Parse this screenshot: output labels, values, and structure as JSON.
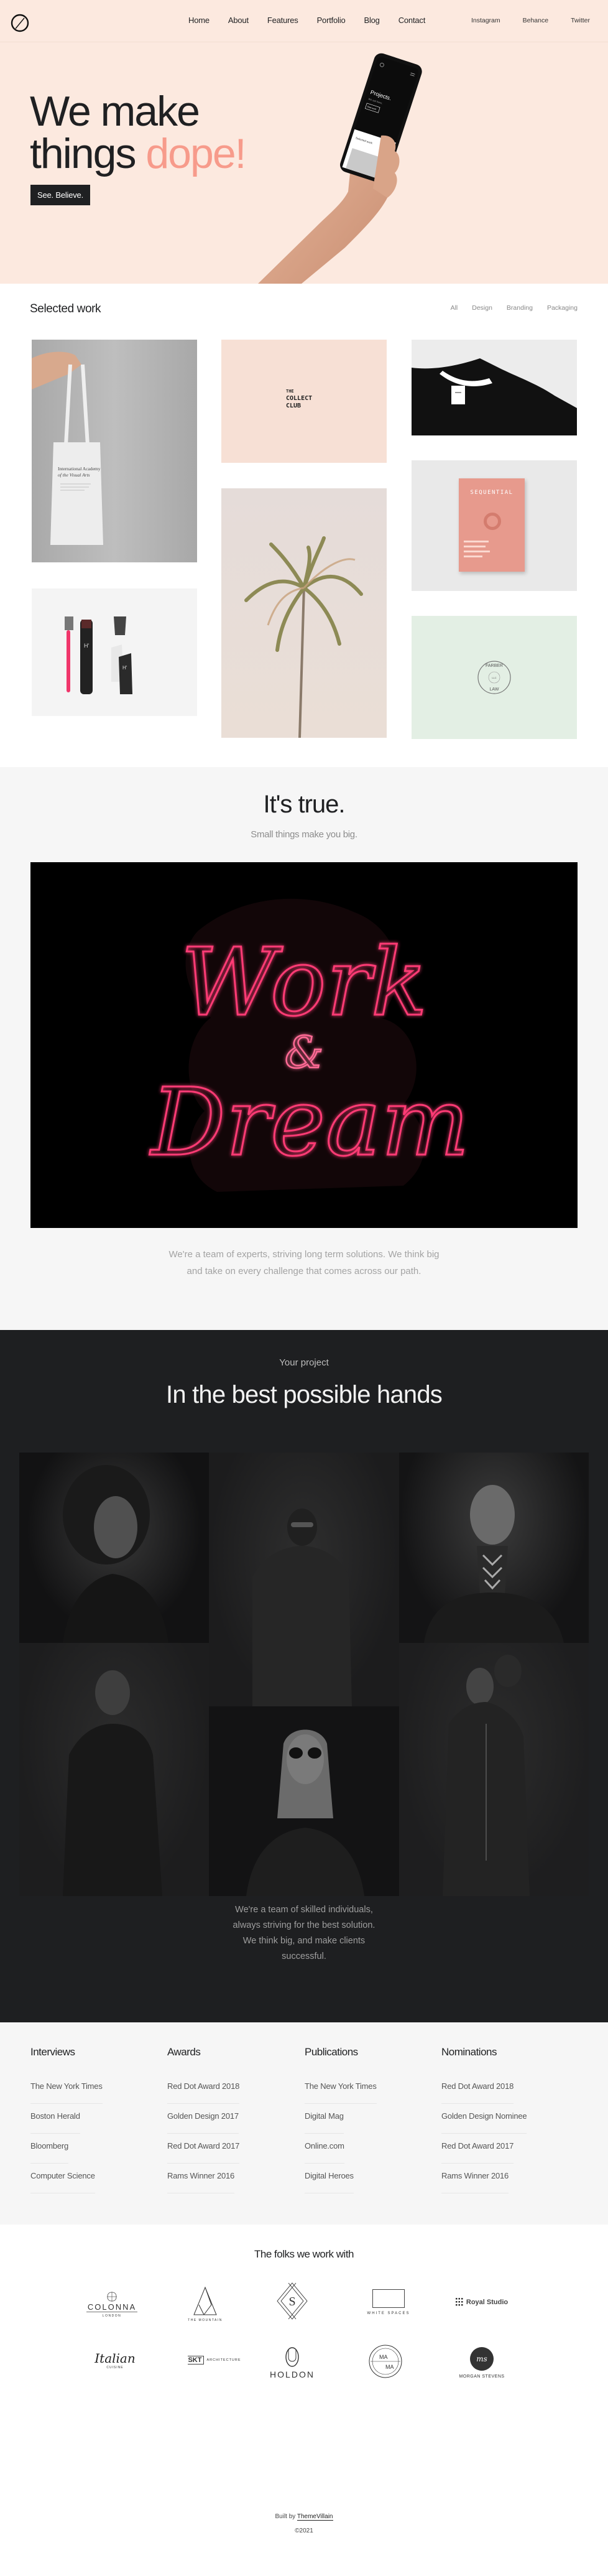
{
  "nav": {
    "logo_icon": "slashed-circle-logo-icon",
    "main": [
      {
        "label": "Home"
      },
      {
        "label": "About"
      },
      {
        "label": "Features"
      },
      {
        "label": "Portfolio"
      },
      {
        "label": "Blog"
      },
      {
        "label": "Contact"
      }
    ],
    "social": [
      {
        "label": "Instagram"
      },
      {
        "label": "Behance"
      },
      {
        "label": "Twitter"
      }
    ]
  },
  "hero": {
    "line1": "We make",
    "line2_plain": "things ",
    "line2_accent": "dope!",
    "cta": "See. Believe.",
    "accent_color": "#f79b8b",
    "background": "#fce9df",
    "phone_screen": {
      "title": "Projects.",
      "subtitle": "We sell them.",
      "button": "View work",
      "section": "Selected work"
    }
  },
  "work": {
    "title": "Selected work",
    "filters": [
      {
        "label": "All"
      },
      {
        "label": "Design"
      },
      {
        "label": "Branding"
      },
      {
        "label": "Packaging"
      }
    ],
    "items": [
      {
        "name": "tote-bag",
        "caption_line1": "International Academy",
        "caption_line2": "of the Visual Arts"
      },
      {
        "name": "razor-kit",
        "mark": "H'"
      },
      {
        "name": "collect-club",
        "line1": "THE",
        "line2": "COLLECT",
        "line3": "CLUB"
      },
      {
        "name": "palm-tree"
      },
      {
        "name": "black-tshirt"
      },
      {
        "name": "sequential-magazine",
        "title": "SEQUENTIAL"
      },
      {
        "name": "farber-law",
        "top": "FARBER",
        "mid": "LLC",
        "bottom": "LAW"
      }
    ]
  },
  "truth": {
    "title": "It's true.",
    "subtitle": "Small things make you big.",
    "neon_line1": "Work",
    "neon_amp": "&",
    "neon_line2": "Dream",
    "paragraph": "We're a team of experts, striving long term solutions. We think big and take on every challenge that comes across our path."
  },
  "project": {
    "kicker": "Your project",
    "title": "In the best possible hands",
    "paragraph": "We're a team of skilled individuals, always striving for the best solution. We think big, and make clients successful."
  },
  "recognition": [
    {
      "title": "Interviews",
      "items": [
        "The New York Times",
        "Boston Herald",
        "Bloomberg",
        "Computer Science"
      ]
    },
    {
      "title": "Awards",
      "items": [
        "Red Dot Award 2018",
        "Golden Design 2017",
        "Red Dot Award 2017",
        "Rams Winner 2016"
      ]
    },
    {
      "title": "Publications",
      "items": [
        "The New York Times",
        "Digital Mag",
        "Online.com",
        "Digital Heroes"
      ]
    },
    {
      "title": "Nominations",
      "items": [
        "Red Dot Award 2018",
        "Golden Design Nominee",
        "Red Dot Award 2017",
        "Rams Winner 2016"
      ]
    }
  ],
  "clients": {
    "title": "The folks we work with",
    "logos": [
      {
        "name": "COLONNA",
        "sub": "LONDON"
      },
      {
        "name": "THE MOUNTAIN"
      },
      {
        "name": "S"
      },
      {
        "name": "WHITE SPACES"
      },
      {
        "name": "Royal Studio"
      },
      {
        "name": "Italian",
        "sub": "CUISINE"
      },
      {
        "name": "SKT",
        "sub": "ARCHITECTURE"
      },
      {
        "name": "HOLDON"
      },
      {
        "name": "MA",
        "sub": "MA"
      },
      {
        "name": "ms",
        "sub": "MORGAN STEVENS"
      }
    ]
  },
  "footer": {
    "built_by": "Built by ",
    "built_link": "ThemeVillain",
    "copyright": "©2021"
  }
}
